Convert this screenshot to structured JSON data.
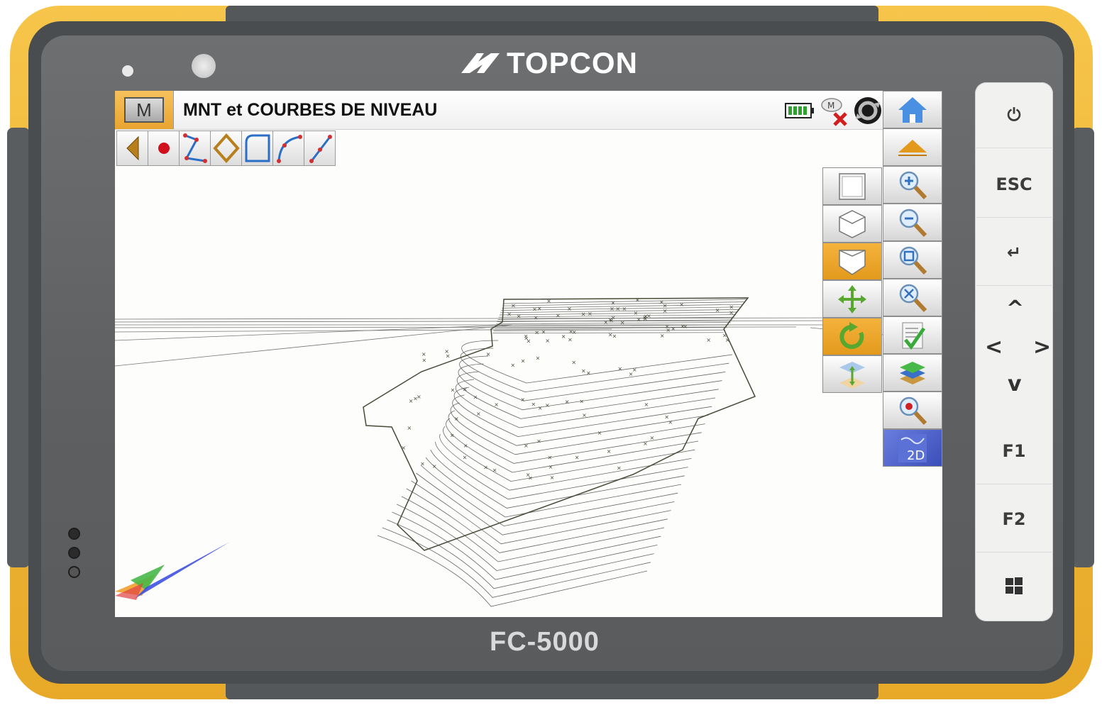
{
  "device": {
    "brand": "TOPCON",
    "model": "FC-5000"
  },
  "app": {
    "menu_button": "M",
    "title": "MNT et COURBES DE NIVEAU"
  },
  "status_icons": [
    "battery-icon",
    "satellite-disconnected-icon",
    "sync-icon"
  ],
  "toolbar": {
    "items": [
      {
        "name": "back-arrow-icon"
      },
      {
        "name": "point-icon"
      },
      {
        "name": "polyline-icon"
      },
      {
        "name": "polygon-icon"
      },
      {
        "name": "rectangle-curve-icon"
      },
      {
        "name": "arc-icon"
      },
      {
        "name": "line-icon"
      }
    ]
  },
  "view_buttons": [
    {
      "name": "top-view-icon",
      "active": false
    },
    {
      "name": "iso-view-icon",
      "active": false
    },
    {
      "name": "perspective-view-icon",
      "active": true
    },
    {
      "name": "pan-icon",
      "active": false
    },
    {
      "name": "rotate-icon",
      "active": true
    },
    {
      "name": "elevation-scale-icon",
      "active": false
    }
  ],
  "right_panel": [
    {
      "name": "home-icon"
    },
    {
      "name": "collapse-up-icon"
    },
    {
      "name": "zoom-in-icon"
    },
    {
      "name": "zoom-out-icon"
    },
    {
      "name": "zoom-window-icon"
    },
    {
      "name": "zoom-extents-icon"
    },
    {
      "name": "checklist-icon"
    },
    {
      "name": "layers-icon"
    },
    {
      "name": "zoom-to-point-icon"
    },
    {
      "name": "view-2d-icon",
      "label": "2D"
    }
  ],
  "hardware_keys": {
    "power": "⏻",
    "esc": "ESC",
    "enter": "↵",
    "up": "^",
    "left": "<",
    "right": ">",
    "down": "v",
    "f1": "F1",
    "f2": "F2",
    "windows": "windows-icon"
  },
  "colors": {
    "bumper": "#f1b837",
    "active_button": "#e9a128",
    "surface_line": "#4a4a3a"
  }
}
